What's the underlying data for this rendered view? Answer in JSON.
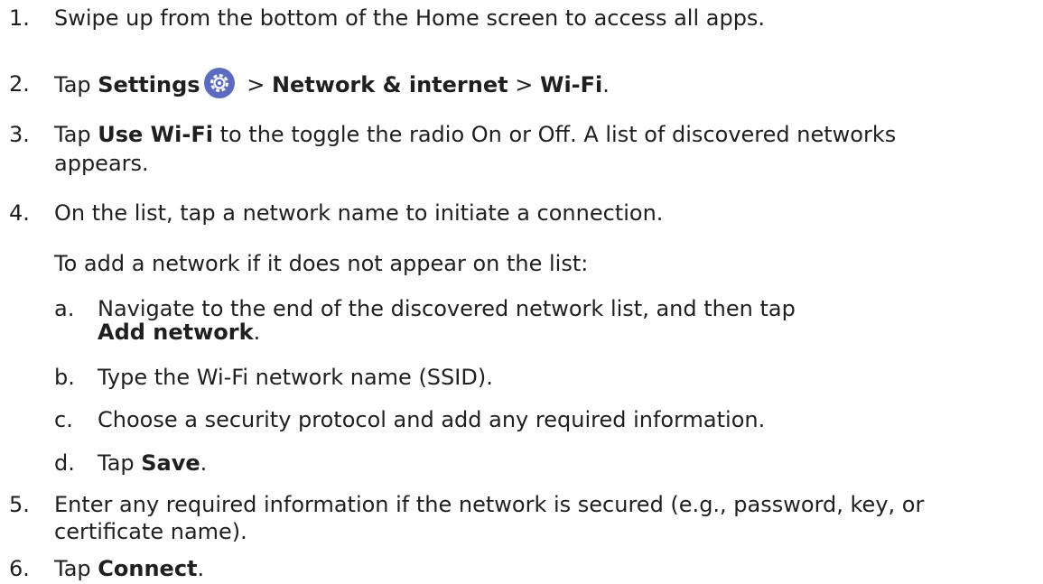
{
  "steps": [
    {
      "num": "1.",
      "text": "Swipe up from the bottom of the Home screen to access all apps."
    },
    {
      "num": "2.",
      "pre": "Tap ",
      "bold1": "Settings",
      "sep1": " > ",
      "bold2": "Network & internet",
      "sep2": " > ",
      "bold3": "Wi-Fi",
      "post": ".",
      "icon": "settings-gear-icon"
    },
    {
      "num": "3.",
      "pre": "Tap ",
      "bold": "Use Wi-Fi",
      "post": " to the toggle the radio On or Off. A list of discovered networks",
      "cont": "appears."
    },
    {
      "num": "4.",
      "text": "On the list, tap a network name to initiate a connection."
    },
    {
      "num": "5.",
      "text": "Enter any required information if the network is secured (e.g., password, key, or",
      "cont": "certificate name)."
    },
    {
      "num": "6.",
      "pre": "Tap ",
      "bold": "Connect",
      "post": "."
    }
  ],
  "note": "To add a network if it does not appear on the list:",
  "substeps": [
    {
      "num": "a.",
      "text": "Navigate to the end of the discovered network list, and then tap",
      "bold": "Add network",
      "post": "."
    },
    {
      "num": "b.",
      "text": "Type the Wi-Fi network name (SSID)."
    },
    {
      "num": "c.",
      "text": "Choose a security protocol and add any required information."
    },
    {
      "num": "d.",
      "pre": "Tap ",
      "bold": "Save",
      "post": "."
    }
  ],
  "colors": {
    "icon_bg": "#5c6bc0",
    "text": "#1f1f1f"
  }
}
